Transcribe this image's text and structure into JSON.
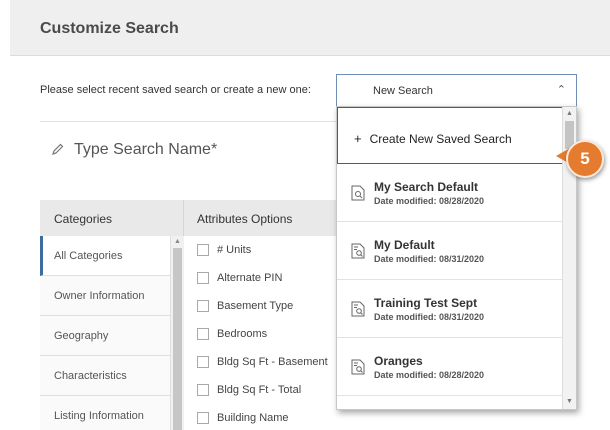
{
  "header": {
    "title": "Customize Search"
  },
  "selector": {
    "prompt": "Please select recent saved search or create a new one:",
    "selected": "New Search"
  },
  "search_name": {
    "placeholder": "Type Search Name*"
  },
  "table": {
    "categories_header": "Categories",
    "attributes_header": "Attributes Options",
    "categories": [
      "All Categories",
      "Owner Information",
      "Geography",
      "Characteristics",
      "Listing Information"
    ],
    "attributes": [
      "# Units",
      "Alternate PIN",
      "Basement Type",
      "Bedrooms",
      "Bldg Sq Ft - Basement",
      "Bldg Sq Ft - Total",
      "Building Name"
    ]
  },
  "dropdown": {
    "create_label": "Create New Saved Search",
    "items": [
      {
        "name": "My Search Default",
        "date": "Date modified: 08/28/2020"
      },
      {
        "name": "My Default",
        "date": "Date modified: 08/31/2020"
      },
      {
        "name": "Training Test Sept",
        "date": "Date modified: 08/31/2020"
      },
      {
        "name": "Oranges",
        "date": "Date modified: 08/28/2020"
      }
    ]
  },
  "callout": {
    "number": "5"
  },
  "colors": {
    "accent": "#3c6d9e",
    "callout": "#e57b2e",
    "header_bg": "#efefef"
  }
}
